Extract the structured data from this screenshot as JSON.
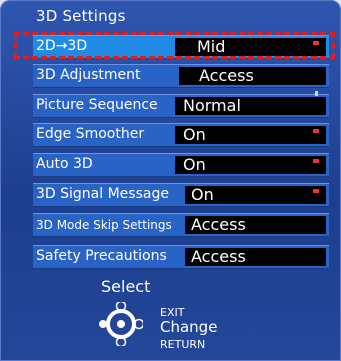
{
  "menu": {
    "title": "3D Settings",
    "items": [
      {
        "label": "2D→3D",
        "value": "Mid",
        "selected": true
      },
      {
        "label": "3D Adjustment",
        "value": "Access"
      },
      {
        "label": "Picture Sequence",
        "value": "Normal"
      },
      {
        "label": "Edge Smoother",
        "value": "On"
      },
      {
        "label": "Auto 3D",
        "value": "On"
      },
      {
        "label": "3D Signal Message",
        "value": "On"
      },
      {
        "label": "3D Mode Skip Settings",
        "value": "Access"
      },
      {
        "label": "Safety Precautions",
        "value": "Access"
      }
    ]
  },
  "footer": {
    "select": "Select",
    "exit": "EXIT",
    "change": "Change",
    "return": "RETURN"
  },
  "colors": {
    "highlight": "#e21d1d",
    "indicator": "#e8343a"
  },
  "icons": {
    "navigation": "dpad-icon"
  }
}
